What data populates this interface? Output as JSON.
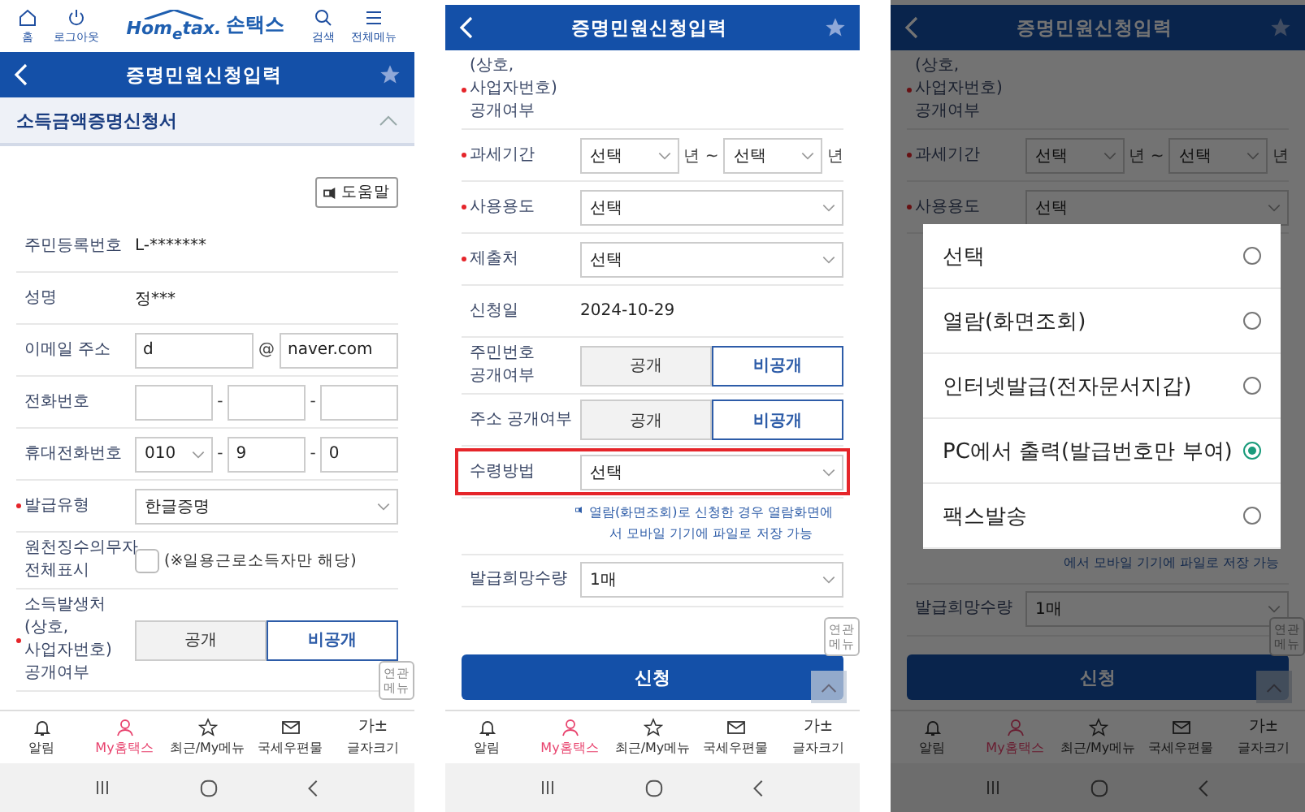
{
  "screens": [
    {
      "top_bar": {
        "home": "홈",
        "logout": "로그아웃",
        "logo": "Hom$_{e}$tax.",
        "brand": "손택스",
        "search": "검색",
        "menu": "전체메뉴"
      },
      "title": "증명민원신청입력",
      "section": {
        "title": "소득금액증명신청서",
        "expanded": true
      },
      "help": "도움말",
      "rows": [
        {
          "kind": "text",
          "label": "주민등록번호",
          "required": false,
          "highlighted": false,
          "value": "L-*******"
        },
        {
          "kind": "text",
          "label": "성명",
          "required": false,
          "highlighted": false,
          "value": "정***"
        },
        {
          "kind": "fields",
          "label": "이메일 주소",
          "required": false,
          "highlighted": false,
          "parts": [
            {
              "kind": "input",
              "value": "d"
            },
            {
              "kind": "sep",
              "text": "@"
            },
            {
              "kind": "input",
              "value": "naver.com"
            }
          ]
        },
        {
          "kind": "fields",
          "label": "전화번호",
          "required": false,
          "highlighted": false,
          "parts": [
            {
              "kind": "input"
            },
            {
              "kind": "sep",
              "text": "-"
            },
            {
              "kind": "input"
            },
            {
              "kind": "sep",
              "text": "-"
            },
            {
              "kind": "input"
            }
          ]
        },
        {
          "kind": "fields",
          "label": "휴대전화번호",
          "required": false,
          "highlighted": false,
          "parts": [
            {
              "kind": "select",
              "value": "010"
            },
            {
              "kind": "sep",
              "text": "-"
            },
            {
              "kind": "input",
              "value": "9"
            },
            {
              "kind": "sep",
              "text": "-"
            },
            {
              "kind": "input",
              "value": "0"
            }
          ]
        },
        {
          "kind": "fields",
          "label": "발급유형",
          "required": true,
          "highlighted": false,
          "parts": [
            {
              "kind": "select",
              "value": "한글증명"
            }
          ]
        },
        {
          "kind": "checkbox",
          "label": "원천징수의무자 전체표시",
          "required": false,
          "highlighted": false,
          "checked": false,
          "text": "(※일용근로소득자만 해당)"
        },
        {
          "kind": "toggle",
          "label": "소득발생처 (상호, 사업자번호) 공개여부",
          "required": true,
          "highlighted": false,
          "options": [
            {
              "label": "공개",
              "selected": false
            },
            {
              "label": "비공개",
              "selected": true
            }
          ]
        }
      ],
      "related_menu": "연관메뉴",
      "nav": [
        {
          "label": "알림",
          "selected": false
        },
        {
          "label": "My홈택스",
          "selected": true
        },
        {
          "label": "최근/My메뉴",
          "selected": false
        },
        {
          "label": "국세우편물",
          "selected": false
        },
        {
          "glyph": "가±",
          "label": "글자크기",
          "selected": false
        }
      ]
    },
    {
      "title": "증명민원신청입력",
      "rows": [
        {
          "kind": "partial",
          "label": "(상호, 사업자번호) 공개여부",
          "required": true,
          "highlighted": false
        },
        {
          "kind": "fields",
          "label": "과세기간",
          "required": true,
          "highlighted": false,
          "parts": [
            {
              "kind": "select",
              "value": "선택"
            },
            {
              "kind": "sep",
              "text": "년 ~"
            },
            {
              "kind": "select",
              "value": "선택"
            },
            {
              "kind": "sep",
              "text": "년"
            }
          ]
        },
        {
          "kind": "fields",
          "label": "사용용도",
          "required": true,
          "highlighted": false,
          "parts": [
            {
              "kind": "select",
              "value": "선택"
            }
          ]
        },
        {
          "kind": "fields",
          "label": "제출처",
          "required": true,
          "highlighted": false,
          "parts": [
            {
              "kind": "select",
              "value": "선택"
            }
          ]
        },
        {
          "kind": "text",
          "label": "신청일",
          "required": false,
          "highlighted": false,
          "value": "2024-10-29"
        },
        {
          "kind": "toggle",
          "label": "주민번호 공개여부",
          "required": false,
          "highlighted": false,
          "options": [
            {
              "label": "공개",
              "selected": false
            },
            {
              "label": "비공개",
              "selected": true
            }
          ]
        },
        {
          "kind": "toggle",
          "label": "주소 공개여부",
          "required": false,
          "highlighted": false,
          "options": [
            {
              "label": "공개",
              "selected": false
            },
            {
              "label": "비공개",
              "selected": true
            }
          ]
        },
        {
          "kind": "fields",
          "label": "수령방법",
          "required": false,
          "highlighted": true,
          "parts": [
            {
              "kind": "select",
              "value": "선택"
            }
          ]
        },
        {
          "kind": "note",
          "speaker": true,
          "text": "열람(화면조회)로 신청한 경우 열람화면에서 모바일 기기에 파일로 저장 가능"
        },
        {
          "kind": "fields",
          "label": "발급희망수량",
          "required": false,
          "highlighted": false,
          "parts": [
            {
              "kind": "select",
              "value": "1매"
            }
          ]
        }
      ],
      "related_menu": "연관메뉴",
      "submit": "신청",
      "scroll_top": true,
      "nav": [
        {
          "label": "알림",
          "selected": false
        },
        {
          "label": "My홈택스",
          "selected": true
        },
        {
          "label": "최근/My메뉴",
          "selected": false
        },
        {
          "label": "국세우편물",
          "selected": false
        },
        {
          "glyph": "가±",
          "label": "글자크기",
          "selected": false
        }
      ]
    },
    {
      "title": "증명민원신청입력",
      "rows": [
        {
          "kind": "partial",
          "label": "(상호, 사업자번호) 공개여부",
          "required": true,
          "highlighted": false
        },
        {
          "kind": "fields",
          "label": "과세기간",
          "required": true,
          "highlighted": false,
          "parts": [
            {
              "kind": "select",
              "value": "선택"
            },
            {
              "kind": "sep",
              "text": "년 ~"
            },
            {
              "kind": "select",
              "value": "선택"
            },
            {
              "kind": "sep",
              "text": "년"
            }
          ]
        },
        {
          "kind": "fields",
          "label": "사용용도",
          "required": true,
          "highlighted": false,
          "parts": [
            {
              "kind": "select",
              "value": "선택"
            }
          ]
        },
        {
          "kind": "dialog",
          "options": [
            {
              "label": "선택",
              "selected": false
            },
            {
              "label": "열람(화면조회)",
              "selected": false
            },
            {
              "label": "인터넷발급(전자문서지갑)",
              "selected": false
            },
            {
              "label": "PC에서 출력(발급번호만 부여)",
              "selected": true
            },
            {
              "label": "팩스발송",
              "selected": false
            }
          ]
        },
        {
          "kind": "note",
          "speaker": false,
          "text": "에서 모바일 기기에 파일로 저장 가능"
        },
        {
          "kind": "fields",
          "label": "발급희망수량",
          "required": false,
          "highlighted": false,
          "parts": [
            {
              "kind": "select",
              "value": "1매"
            }
          ]
        }
      ],
      "related_menu": "연관메뉴",
      "submit": "신청",
      "scroll_top": true,
      "nav": [
        {
          "label": "알림",
          "selected": false
        },
        {
          "label": "My홈택스",
          "selected": true
        },
        {
          "label": "최근/My메뉴",
          "selected": false
        },
        {
          "label": "국세우편물",
          "selected": false
        },
        {
          "glyph": "가±",
          "label": "글자크기",
          "selected": false
        }
      ]
    }
  ]
}
